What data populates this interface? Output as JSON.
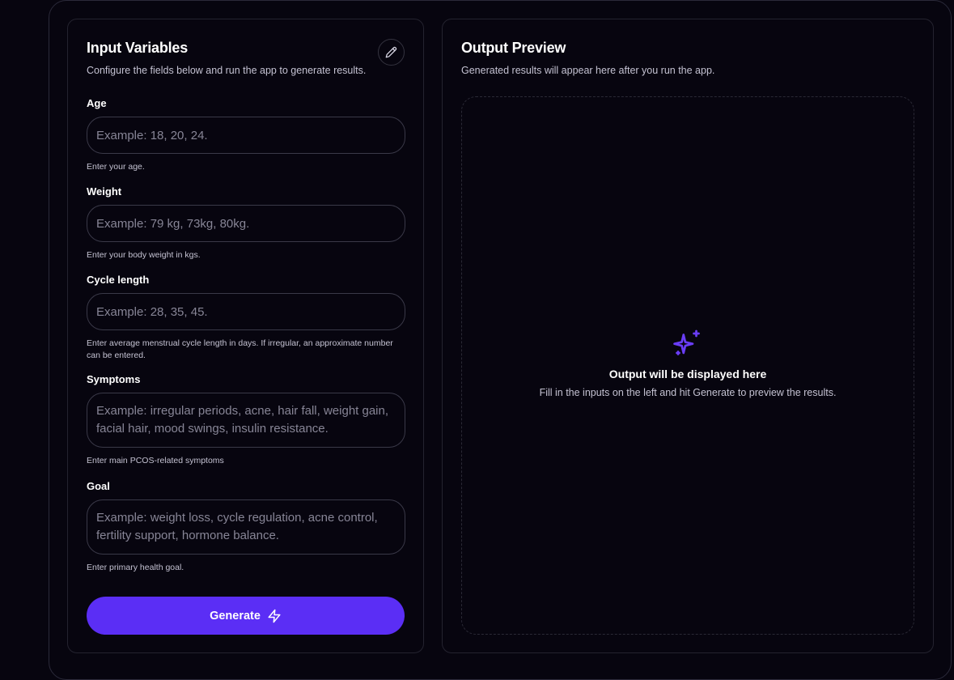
{
  "input_panel": {
    "title": "Input Variables",
    "subtitle": "Configure the fields below and run the app to generate results.",
    "edit_icon": "pencil-icon",
    "fields": [
      {
        "label": "Age",
        "placeholder": "Example: 18, 20, 24.",
        "value": "",
        "help": "Enter your age."
      },
      {
        "label": "Weight",
        "placeholder": "Example: 79 kg, 73kg, 80kg.",
        "value": "",
        "help": "Enter your body weight in kgs."
      },
      {
        "label": "Cycle length",
        "placeholder": "Example: 28, 35, 45.",
        "value": "",
        "help": "Enter average menstrual cycle length in days. If irregular, an approximate number can be entered."
      },
      {
        "label": "Symptoms",
        "placeholder": "Example: irregular periods, acne, hair fall, weight gain, facial hair, mood swings, insulin resistance.",
        "value": "",
        "help": "Enter main PCOS-related symptoms"
      },
      {
        "label": "Goal",
        "placeholder": "Example: weight loss, cycle regulation, acne control, fertility support, hormone balance.",
        "value": "",
        "help": "Enter primary health goal."
      }
    ],
    "generate_label": "Generate",
    "generate_icon": "lightning-icon"
  },
  "output_panel": {
    "title": "Output Preview",
    "subtitle": "Generated results will appear here after you run the app.",
    "empty_icon": "sparkles-icon",
    "empty_title": "Output will be displayed here",
    "empty_subtitle": "Fill in the inputs on the left and hit Generate to preview the results."
  },
  "colors": {
    "background": "#07050f",
    "accent": "#5b2ef5",
    "border": "#24232f",
    "muted_text": "#c4c2d2",
    "placeholder_text": "#878596"
  }
}
